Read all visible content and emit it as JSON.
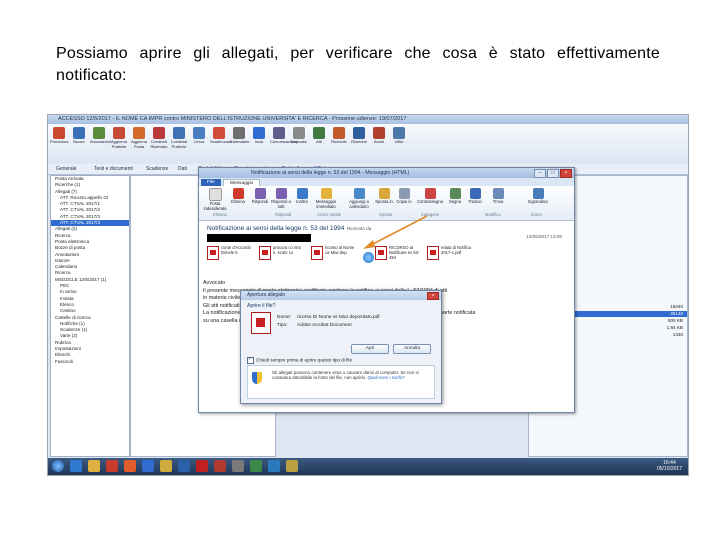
{
  "caption": "Possiamo aprire gli allegati, per verificare che cosa è stato effettivamente notificato:",
  "outlook": {
    "title": "ACCESSO 12/5/2017 - IL NOME CA IMPR contro MINISTERO DELL'ISTRUZIONE UNIVERSITA' E RICERCA - Prossime udienze: 19/07/2017",
    "ribbon": [
      "Procedura",
      "Nuovo",
      "Annotazioni",
      "Aggiorna Pratiche",
      "Aggiorna Posta",
      "Condividi Riservato",
      "Condividi Pratiche",
      "Cerca",
      "Scadenzario",
      "Calendario",
      "Invia",
      "Comunicazione",
      "Deposito",
      "Atti",
      "Ricevute",
      "Ricerche",
      "Avvisi",
      "Uffici",
      "Anagrafica",
      "Revisione"
    ],
    "nav": [
      "Generale",
      "Testi e documenti",
      "Scadenze",
      "Dati",
      "Contabilità",
      "Completamenti",
      "Dettagli",
      "Ufficio"
    ],
    "folders": [
      "Posta Arrivata",
      "Ricerche (1)",
      "Allegati (7)",
      "ATT. Ricorso appello GI",
      "ATT. CTVAL 2017/1",
      "ATT. CTVAL 2017/2",
      "ATT. CTVAL 2017/3",
      "ATT. CTVAL 2017/3",
      "Allegati (2)",
      "Ricerca",
      "Posta elettronica",
      "Bozze di posta",
      "Annotazioni",
      "Istanze",
      "Calendario",
      "Ricerca",
      "MSGDCLE 12/5/2017 (1)",
      "PEC",
      "In arrivo",
      "Inviata",
      "Elenco",
      "Cestino",
      "Cartelle di ricerca",
      "Notifiche (1)",
      "Scadenze (1)",
      "Varie (2)",
      "Rubrica",
      "Impostazioni",
      "Elenchi",
      "Fascicoli"
    ],
    "right_numbers": [
      "15040",
      "36140",
      "509 KB",
      "1.84 KB",
      "1346"
    ],
    "clock_time": "16:44",
    "clock_date": "05/10/2017"
  },
  "message": {
    "title": "Notificazione ai sensi della legge n. 53 del 1994 - Messaggio (HTML)",
    "tabs": [
      "File",
      "Messaggio"
    ],
    "buttons": [
      "Posta indesiderata",
      "Elimina",
      "Rispondi",
      "Rispondi a tutti",
      "Inoltra",
      "Messaggio immediato",
      "Aggiungi a calendario",
      "Sposta in",
      "Copia in",
      "Contrassegna",
      "Segna",
      "Traduci",
      "Trova",
      "Ingrandisci"
    ],
    "groups": [
      "Elimina",
      "Rispondi",
      "Azioni rapide",
      "Sposta",
      "Categorie",
      "Modifica",
      "Zoom"
    ],
    "subject": "Notificazione ai sensi della legge n. 53 del 1994",
    "from_label": "Ricevuto da",
    "date": "12/05/2017 13:00",
    "attachments": [
      {
        "name": "conte d'Accordo Dimele 5"
      },
      {
        "name": "procura co ntro n. scolo 1o"
      },
      {
        "name": "ricorso al Nome ca Miur.dep"
      },
      {
        "name": "RICORSO al Notificare ex 53-494"
      },
      {
        "name": "relata di Notifica 2017-1.pdf"
      }
    ],
    "body_lines": [
      "Avvocato",
      "Il presente messaggio di posta elettronica certificata contiene la notifica ai sensi della L. 53/1994 di atti",
      "in materia civile, amministrativa e stragiudiziale.",
      "Gli atti notificati sono allegati al presente messaggio.",
      "La notificazione si è perfezionata con la ricezione della ricevuta di consegna nella casella pec della parte notificata",
      "su una casella di posta elettronica certificata."
    ]
  },
  "dialog": {
    "title": "Apertura allegato",
    "question": "Aprire il file?",
    "name_label": "Nome:",
    "name_value": "ricorso Di Nome vs Miur depositato.pdf",
    "type_label": "Tipo:",
    "type_value": "Adobe Acrobat Document",
    "open_button": "Apri",
    "cancel_button": "Annulla",
    "checkbox": "Chiedi sempre prima di aprire questo tipo di file",
    "warning": "Gli allegati possono contenere virus o causare danni al computer. Se non si considera attendibile la fonte del file, non aprirlo.",
    "warning_link": "Quali sono i rischi?"
  },
  "colors": {
    "accent": "#2f6bd0",
    "pdf_red": "#c82020",
    "arrow": "#e08a2a"
  }
}
